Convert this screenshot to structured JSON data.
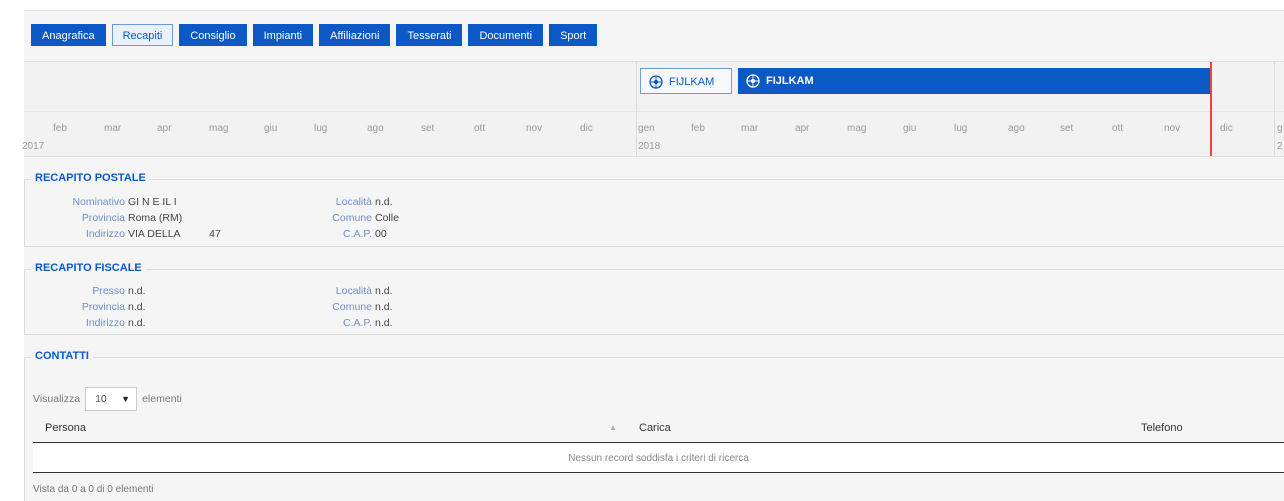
{
  "tabs": [
    {
      "label": "Anagrafica",
      "active": false
    },
    {
      "label": "Recapiti",
      "active": true
    },
    {
      "label": "Consiglio",
      "active": false
    },
    {
      "label": "Impianti",
      "active": false
    },
    {
      "label": "Affiliazioni",
      "active": false
    },
    {
      "label": "Tesserati",
      "active": false
    },
    {
      "label": "Documenti",
      "active": false
    },
    {
      "label": "Sport",
      "active": false
    }
  ],
  "timeline": {
    "items": [
      {
        "label": "FIJLKAM",
        "style": "outline",
        "icon": "federation-logo-icon"
      },
      {
        "label": "FIJLKAM",
        "style": "filled",
        "icon": "federation-logo-icon"
      }
    ],
    "months_2017": [
      "feb",
      "mar",
      "apr",
      "mag",
      "giu",
      "lug",
      "ago",
      "set",
      "ott",
      "nov",
      "dic"
    ],
    "months_2018": [
      "gen",
      "feb",
      "mar",
      "apr",
      "mag",
      "giu",
      "lug",
      "ago",
      "set",
      "ott",
      "nov",
      "dic"
    ],
    "next_month": "g",
    "year_2017": "2017",
    "year_2018": "2018",
    "next_year": "2"
  },
  "postale": {
    "title": "RECAPITO POSTALE",
    "nominativo_label": "Nominativo",
    "nominativo": "GI  N  E  IL    I",
    "provincia_label": "Provincia",
    "provincia": "Roma (RM)",
    "indirizzo_label": "Indirizzo",
    "indirizzo": "VIA DELLA          47",
    "localita_label": "Località",
    "localita": "n.d.",
    "comune_label": "Comune",
    "comune": "Colle",
    "cap_label": "C.A.P.",
    "cap": "00"
  },
  "fiscale": {
    "title": "RECAPITO FISCALE",
    "presso_label": "Presso",
    "presso": "n.d.",
    "provincia_label": "Provincia",
    "provincia": "n.d.",
    "indirizzo_label": "Indirizzo",
    "indirizzo": "n.d.",
    "localita_label": "Località",
    "localita": "n.d.",
    "comune_label": "Comune",
    "comune": "n.d.",
    "cap_label": "C.A.P.",
    "cap": "n.d."
  },
  "contatti": {
    "title": "CONTATTI",
    "visualizza": "Visualizza",
    "page_size": "10",
    "elementi": "elementi",
    "columns": [
      "Persona",
      "Carica",
      "Telefono"
    ],
    "empty_text": "Nessun record soddisfa i criteri di ricerca",
    "info": "Vista da 0 a 0 di 0 elementi"
  },
  "colors": {
    "accent": "#0b59c6",
    "today_line": "#e8453c"
  }
}
